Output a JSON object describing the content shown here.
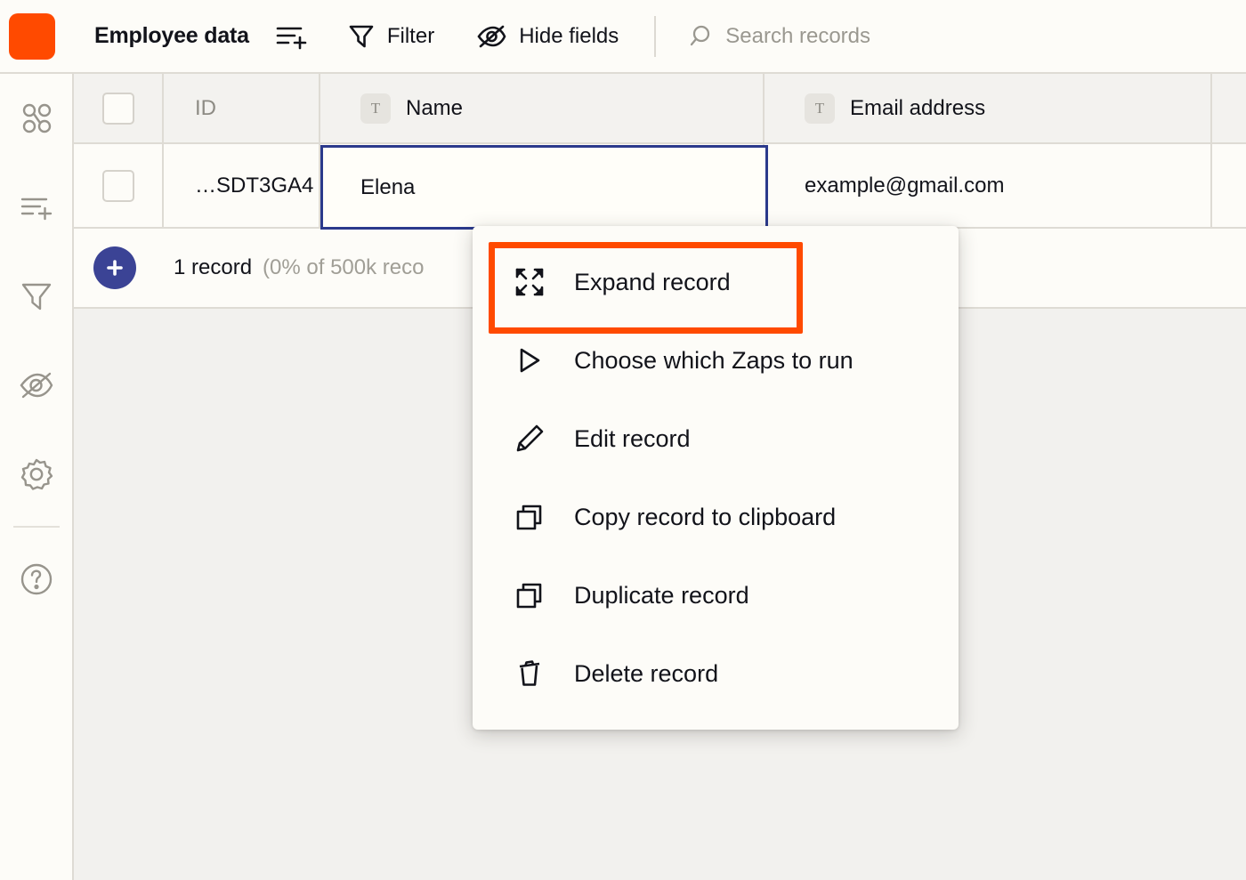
{
  "app": {
    "title": "Employee data",
    "logo_color": "#ff4a00",
    "accent_color": "#ff4a00",
    "selection_color": "#2b3a8c"
  },
  "toolbar": {
    "sort_add_label": "",
    "filter_label": "Filter",
    "hide_fields_label": "Hide fields",
    "search_placeholder": "Search records"
  },
  "rail": {
    "items": [
      {
        "icon": "apps-icon"
      },
      {
        "icon": "add-field-icon"
      },
      {
        "icon": "filter-icon"
      },
      {
        "icon": "hide-fields-icon"
      },
      {
        "icon": "gear-icon"
      },
      {
        "icon": "help-icon"
      }
    ]
  },
  "table": {
    "columns": [
      {
        "label": "ID",
        "type_badge": ""
      },
      {
        "label": "Name",
        "type_badge": "T"
      },
      {
        "label": "Email address",
        "type_badge": "T"
      }
    ],
    "rows": [
      {
        "id": "…SDT3GA4",
        "name": "Elena",
        "email": "example@gmail.com"
      }
    ],
    "selected_cell_value": "Elena"
  },
  "footer": {
    "record_count": "1 record",
    "record_detail": "(0% of 500k reco",
    "add_button_label": "+"
  },
  "context_menu": {
    "highlighted_index": 0,
    "items": [
      {
        "label": "Expand record",
        "icon": "expand-icon"
      },
      {
        "label": "Choose which Zaps to run",
        "icon": "play-icon"
      },
      {
        "label": "Edit record",
        "icon": "pencil-icon"
      },
      {
        "label": "Copy record to clipboard",
        "icon": "copy-icon"
      },
      {
        "label": "Duplicate record",
        "icon": "duplicate-icon"
      },
      {
        "label": "Delete record",
        "icon": "trash-icon"
      }
    ]
  }
}
